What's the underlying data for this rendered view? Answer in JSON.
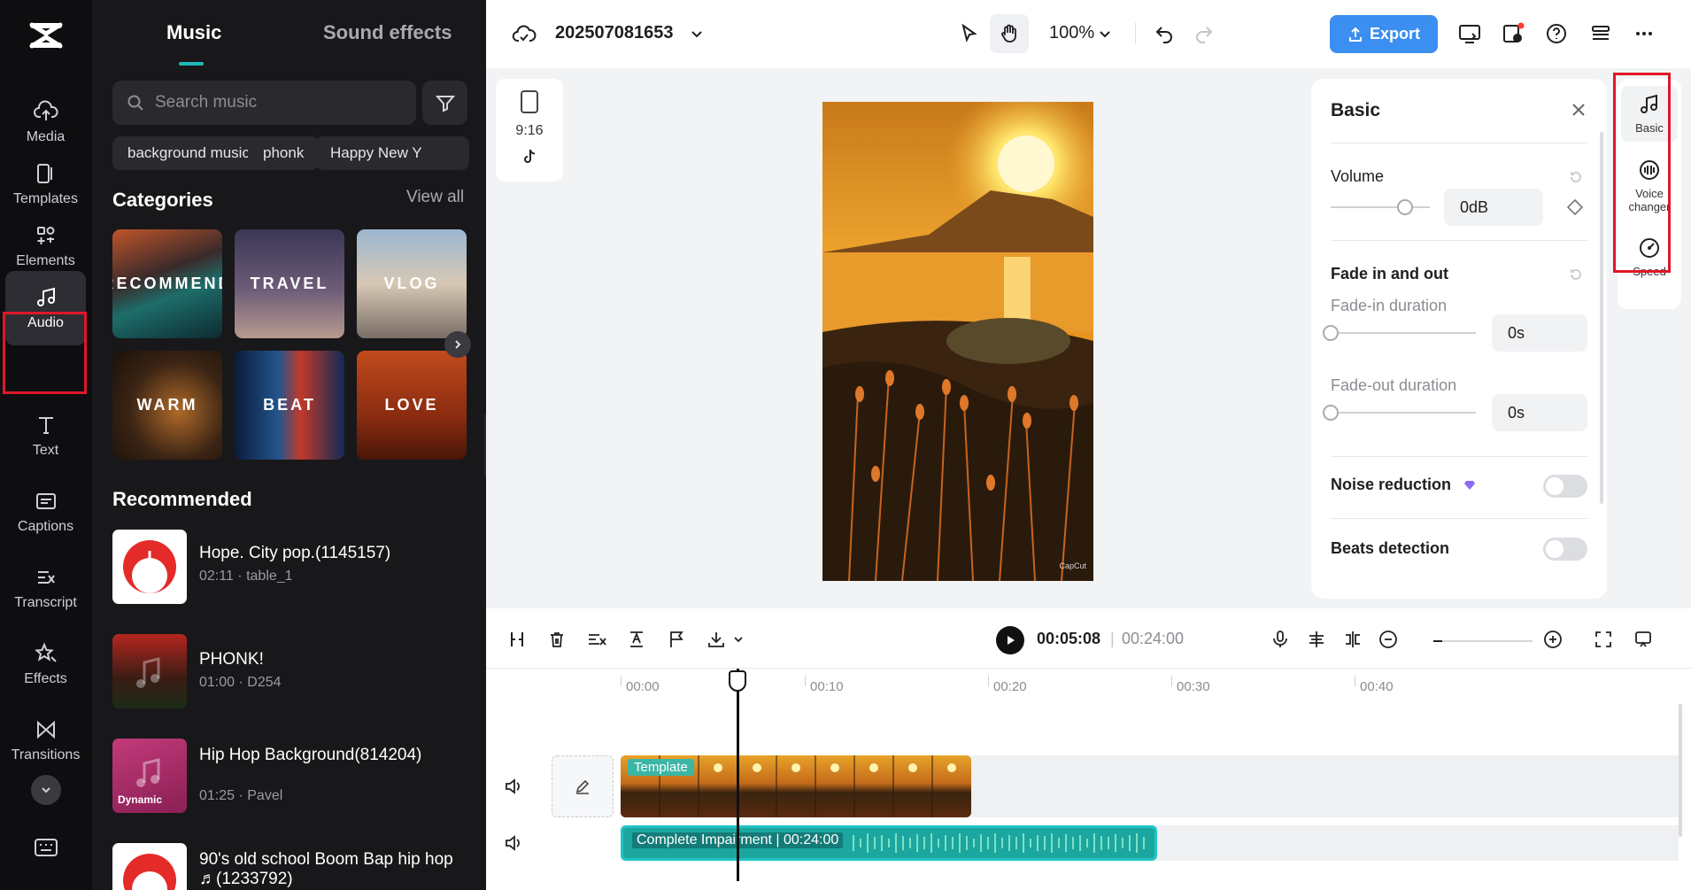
{
  "rail": {
    "items": [
      {
        "label": "Media",
        "icon": "cloud-upload-icon"
      },
      {
        "label": "Templates",
        "icon": "templates-icon"
      },
      {
        "label": "Elements",
        "icon": "elements-icon"
      },
      {
        "label": "Audio",
        "icon": "music-note-icon",
        "active": true
      },
      {
        "label": "Text",
        "icon": "text-icon"
      },
      {
        "label": "Captions",
        "icon": "captions-icon"
      },
      {
        "label": "Transcript",
        "icon": "transcript-icon"
      },
      {
        "label": "Effects",
        "icon": "effects-icon"
      },
      {
        "label": "Transitions",
        "icon": "transitions-icon"
      }
    ]
  },
  "panel": {
    "tabs": [
      "Music",
      "Sound effects"
    ],
    "search_placeholder": "Search music",
    "chips": [
      "background music",
      "phonk",
      "Happy New Y"
    ],
    "categories_title": "Categories",
    "view_all": "View all",
    "categories": [
      "RECOMMEND",
      "TRAVEL",
      "VLOG",
      "WARM",
      "BEAT",
      "LOVE"
    ],
    "recommended_title": "Recommended",
    "songs": [
      {
        "title": "Hope. City pop.(1145157)",
        "meta": "02:11 · table_1"
      },
      {
        "title": "PHONK!",
        "meta": "01:00 · D254"
      },
      {
        "title": "Hip Hop Background(814204)",
        "meta": "01:25 · Pavel",
        "badge": "Dynamic"
      },
      {
        "title": "90's old school Boom Bap hip hop ♬(1233792)",
        "meta": ""
      }
    ]
  },
  "topbar": {
    "project_name": "202507081653",
    "zoom": "100%",
    "export_label": "Export"
  },
  "stage": {
    "ratio_label": "9:16",
    "watermark": "CapCut"
  },
  "properties": {
    "title": "Basic",
    "volume_label": "Volume",
    "volume_value": "0dB",
    "volume_level": 0.75,
    "fade_label": "Fade in and out",
    "fade_in_label": "Fade-in duration",
    "fade_in_value": "0s",
    "fade_out_label": "Fade-out duration",
    "fade_out_value": "0s",
    "noise_label": "Noise reduction",
    "beats_label": "Beats detection",
    "side_tabs": [
      {
        "label": "Basic",
        "icon": "music-note-icon"
      },
      {
        "label": "Voice changer",
        "icon": "voice-changer-icon"
      },
      {
        "label": "Speed",
        "icon": "speed-icon"
      }
    ]
  },
  "timeline": {
    "current_time": "00:05:08",
    "total_time": "00:24:00",
    "ticks": [
      "00:00",
      "00:10",
      "00:20",
      "00:30",
      "00:40"
    ],
    "video_clip_label": "Template",
    "audio_clip_label": "Complete Impairment",
    "audio_clip_duration": "00:24:00"
  }
}
